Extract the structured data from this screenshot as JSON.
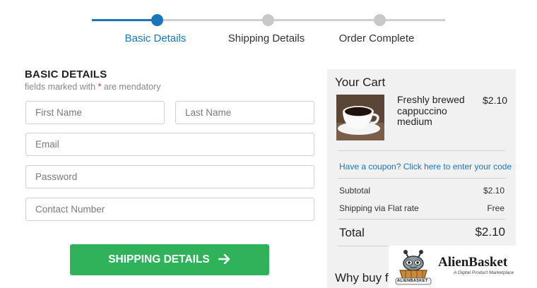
{
  "stepper": {
    "steps": [
      {
        "label": "Basic Details",
        "state": "active"
      },
      {
        "label": "Shipping Details",
        "state": "inactive"
      },
      {
        "label": "Order Complete",
        "state": "inactive"
      }
    ]
  },
  "form": {
    "heading": "BASIC DETAILS",
    "sub_prefix": "fields marked with ",
    "sub_star": "*",
    "sub_suffix": " are mendatory",
    "fields": {
      "first_name": {
        "placeholder": "First Name",
        "value": ""
      },
      "last_name": {
        "placeholder": "Last Name",
        "value": ""
      },
      "email": {
        "placeholder": "Email",
        "value": ""
      },
      "password": {
        "placeholder": "Password",
        "value": ""
      },
      "contact": {
        "placeholder": "Contact Number",
        "value": ""
      }
    },
    "submit_label": "SHIPPING DETAILS",
    "submit_icon": "arrow-right-icon"
  },
  "cart": {
    "title": "Your Cart",
    "item": {
      "name": "Freshly brewed cappuccino medium",
      "price": "$2.10",
      "image": "coffee-cup"
    },
    "coupon_text": "Have a coupon? Click here to enter your code",
    "subtotal_label": "Subtotal",
    "subtotal_value": "$2.10",
    "shipping_label": "Shipping via Flat rate",
    "shipping_value": "Free",
    "total_label": "Total",
    "total_value": "$2.10",
    "why_buy": "Why buy f"
  },
  "logo": {
    "name": "AlienBasket",
    "tagline": "A Digital Product Marketplace",
    "badge_text": "ALIENBASKET"
  },
  "colors": {
    "accent": "#1a75bb",
    "button": "#2fb25a",
    "required": "#e0262d",
    "cart_bg": "#f1f1f1"
  }
}
